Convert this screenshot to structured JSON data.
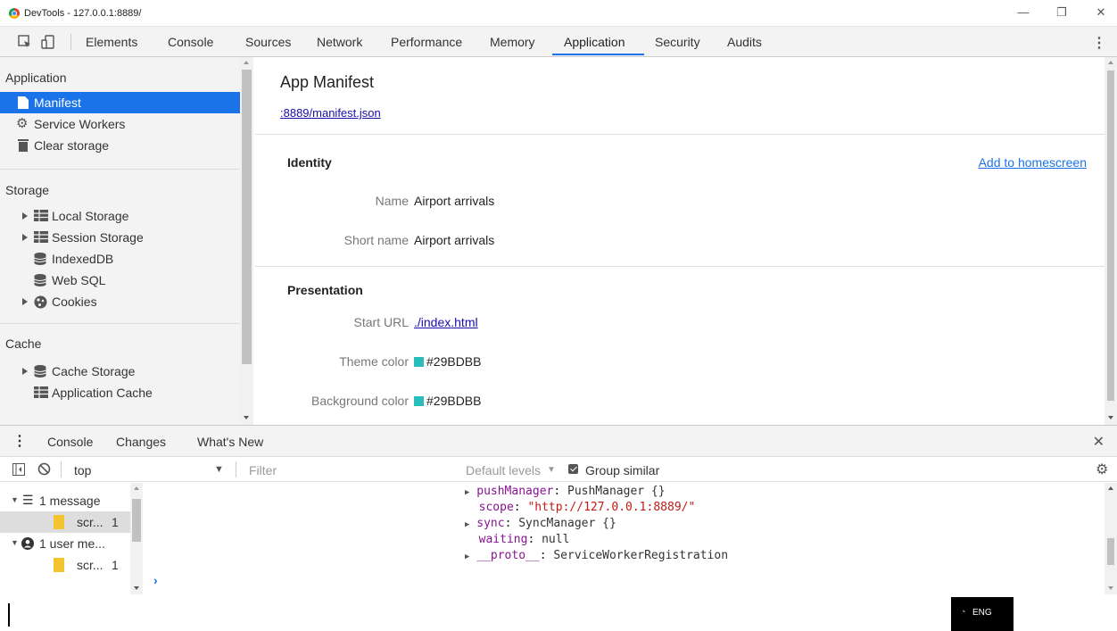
{
  "window": {
    "title": "DevTools - 127.0.0.1:8889/",
    "controls": {
      "minimize": "—",
      "restore": "❐",
      "close": "✕"
    }
  },
  "toolbar": {
    "tabs": [
      "Elements",
      "Console",
      "Sources",
      "Network",
      "Performance",
      "Memory",
      "Application",
      "Security",
      "Audits"
    ],
    "active_tab": "Application",
    "more": "⋮"
  },
  "sidebar": {
    "sections": [
      {
        "title": "Application",
        "items": [
          {
            "label": "Manifest",
            "icon": "file-icon",
            "selected": true
          },
          {
            "label": "Service Workers",
            "icon": "gear-icon"
          },
          {
            "label": "Clear storage",
            "icon": "trash-icon"
          }
        ]
      },
      {
        "title": "Storage",
        "items": [
          {
            "label": "Local Storage",
            "icon": "grid-icon",
            "expandable": true
          },
          {
            "label": "Session Storage",
            "icon": "grid-icon",
            "expandable": true
          },
          {
            "label": "IndexedDB",
            "icon": "database-icon"
          },
          {
            "label": "Web SQL",
            "icon": "database-icon"
          },
          {
            "label": "Cookies",
            "icon": "cookie-icon",
            "expandable": true
          }
        ]
      },
      {
        "title": "Cache",
        "items": [
          {
            "label": "Cache Storage",
            "icon": "database-icon",
            "expandable": true
          },
          {
            "label": "Application Cache",
            "icon": "grid-icon"
          }
        ]
      }
    ]
  },
  "main": {
    "title": "App Manifest",
    "manifest_link": ":8889/manifest.json",
    "identity": {
      "title": "Identity",
      "add_to_homescreen": "Add to homescreen",
      "name_label": "Name",
      "name_value": "Airport arrivals",
      "short_name_label": "Short name",
      "short_name_value": "Airport arrivals"
    },
    "presentation": {
      "title": "Presentation",
      "start_url_label": "Start URL",
      "start_url_value": "./index.html",
      "theme_color_label": "Theme color",
      "theme_color_value": "#29BDBB",
      "background_color_label": "Background color",
      "background_color_value": "#29BDBB"
    },
    "swatch_color": "#29BDBB"
  },
  "drawer": {
    "tabs": [
      "Console",
      "Changes",
      "What's New"
    ],
    "close": "✕",
    "menu": "⋮"
  },
  "console_toolbar": {
    "context": "top",
    "filter_placeholder": "Filter",
    "levels": "Default levels",
    "levels_arrow": "▼",
    "group_similar": "Group similar"
  },
  "console_sidebar": {
    "items": [
      {
        "label": "1 message",
        "icon": "list-icon"
      },
      {
        "label": "scr...",
        "count": "1",
        "icon": "file-icon"
      },
      {
        "label": "1 user me...",
        "icon": "user-icon"
      },
      {
        "label": "scr...",
        "count": "1",
        "icon": "file-icon"
      }
    ]
  },
  "console_output": {
    "lines": [
      {
        "arrow": "▶",
        "key": "pushManager",
        "value": "PushManager {}"
      },
      {
        "key": "scope",
        "value": "\"http://127.0.0.1:8889/\""
      },
      {
        "arrow": "▶",
        "key": "sync",
        "value": "SyncManager {}"
      },
      {
        "key": "waiting",
        "value": "null"
      },
      {
        "arrow": "▶",
        "key": "__proto__",
        "value": "ServiceWorkerRegistration"
      }
    ],
    "prompt": "›"
  },
  "taskbar": {
    "lang": "ENG"
  }
}
